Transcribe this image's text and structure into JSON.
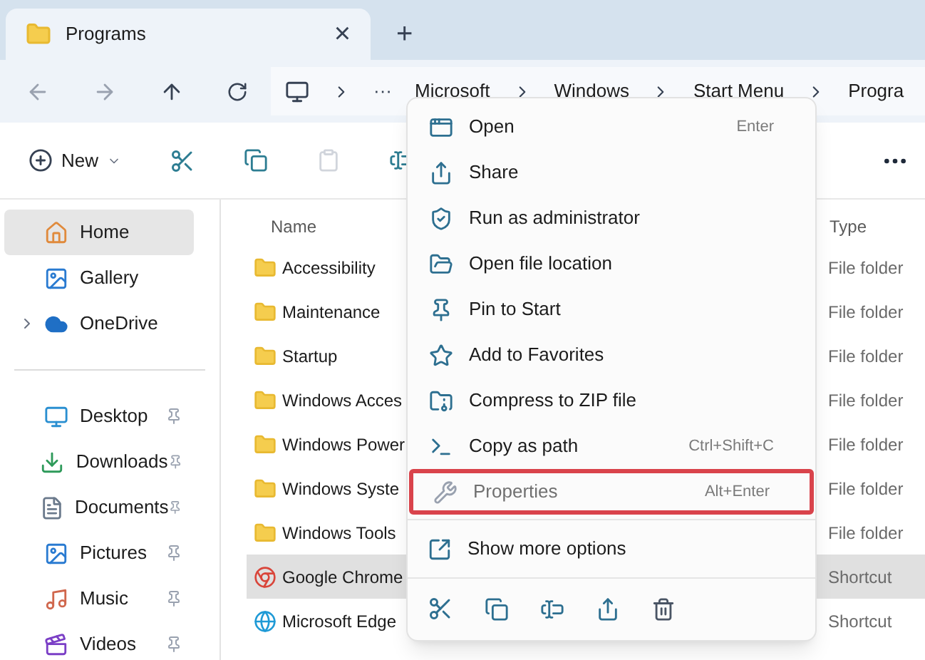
{
  "tab": {
    "title": "Programs",
    "close": "×",
    "new_tab": "+"
  },
  "breadcrumb": {
    "overflow": "···",
    "items": [
      "Microsoft",
      "Windows",
      "Start Menu",
      "Progra"
    ]
  },
  "toolbar": {
    "new_label": "New"
  },
  "sidebar": {
    "items": [
      {
        "label": "Home",
        "selected": true,
        "pinned": false,
        "expandable": false
      },
      {
        "label": "Gallery",
        "selected": false,
        "pinned": false,
        "expandable": false
      },
      {
        "label": "OneDrive",
        "selected": false,
        "pinned": false,
        "expandable": true
      }
    ],
    "quick_access": [
      {
        "label": "Desktop",
        "selected": false,
        "pinned": true,
        "expandable": false
      },
      {
        "label": "Downloads",
        "selected": false,
        "pinned": true,
        "expandable": false
      },
      {
        "label": "Documents",
        "selected": false,
        "pinned": true,
        "expandable": false
      },
      {
        "label": "Pictures",
        "selected": false,
        "pinned": true,
        "expandable": false
      },
      {
        "label": "Music",
        "selected": false,
        "pinned": true,
        "expandable": false
      },
      {
        "label": "Videos",
        "selected": false,
        "pinned": true,
        "expandable": false
      }
    ]
  },
  "files": {
    "columns": [
      "Name",
      "Type"
    ],
    "rows": [
      {
        "name": "Accessibility",
        "type": "File folder",
        "kind": "folder",
        "selected": false
      },
      {
        "name": "Maintenance",
        "type": "File folder",
        "kind": "folder",
        "selected": false
      },
      {
        "name": "Startup",
        "type": "File folder",
        "kind": "folder",
        "selected": false
      },
      {
        "name": "Windows Acces",
        "type": "File folder",
        "kind": "folder",
        "selected": false
      },
      {
        "name": "Windows Power",
        "type": "File folder",
        "kind": "folder",
        "selected": false
      },
      {
        "name": "Windows Syste",
        "type": "File folder",
        "kind": "folder",
        "selected": false
      },
      {
        "name": "Windows Tools",
        "type": "File folder",
        "kind": "folder",
        "selected": false
      },
      {
        "name": "Google Chrome",
        "type": "Shortcut",
        "kind": "chrome",
        "selected": true
      },
      {
        "name": "Microsoft Edge",
        "type": "Shortcut",
        "kind": "edge",
        "selected": false
      }
    ]
  },
  "context_menu": {
    "items": [
      {
        "label": "Open",
        "shortcut": "Enter",
        "highlighted": false
      },
      {
        "label": "Share",
        "highlighted": false
      },
      {
        "label": "Run as administrator",
        "highlighted": false
      },
      {
        "label": "Open file location",
        "highlighted": false
      },
      {
        "label": "Pin to Start",
        "highlighted": false
      },
      {
        "label": "Add to Favorites",
        "highlighted": false
      },
      {
        "label": "Compress to ZIP file",
        "highlighted": false
      },
      {
        "label": "Copy as path",
        "shortcut": "Ctrl+Shift+C",
        "highlighted": false
      },
      {
        "label": "Properties",
        "shortcut": "Alt+Enter",
        "highlighted": true
      }
    ],
    "more": {
      "label": "Show more options"
    }
  }
}
